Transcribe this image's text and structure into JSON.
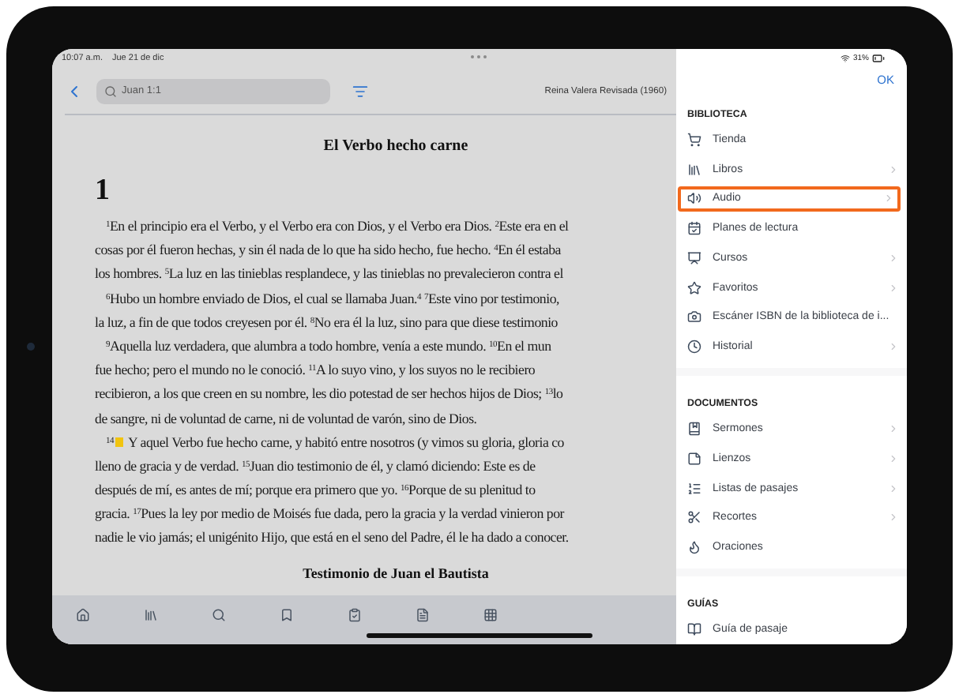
{
  "status_bar": {
    "time": "10:07 a.m.",
    "date": "Jue 21 de dic",
    "battery": "31%"
  },
  "reader": {
    "search": {
      "value": "Juan 1:1"
    },
    "version": "Reina Valera Revisada (1960)",
    "heading": "El Verbo hecho carne",
    "chapter": "1",
    "lines": [
      {
        "text": "$^{1}$En el principio era el Verbo, y el Verbo era con Dios, y el Verbo era Dios. $^{2}$Este era en el",
        "indented": true,
        "note_marker": false
      },
      {
        "text": "cosas por él fueron hechas, y sin él nada de lo que ha sido hecho, fue hecho. $^{4}$En él estaba",
        "indented": false,
        "note_marker": false
      },
      {
        "text": "los hombres. $^{5}$La luz en las tinieblas resplandece, y las tinieblas no prevalecieron contra el",
        "indented": false,
        "note_marker": false
      },
      {
        "text": "$^{6}$Hubo un hombre enviado de Dios, el cual se llamaba Juan.$^{4}$ $^{7}$Este vino por testimonio,",
        "indented": true,
        "note_marker": false
      },
      {
        "text": "la luz, a fin de que todos creyesen por él. $^{8}$No era él la luz, sino para que diese testimonio",
        "indented": false,
        "note_marker": false
      },
      {
        "text": "$^{9}$Aquella luz verdadera, que alumbra a todo hombre, venía a este mundo. $^{10}$En el mun",
        "indented": true,
        "note_marker": false
      },
      {
        "text": "fue hecho; pero el mundo no le conoció. $^{11}$A lo suyo vino, y los suyos no le recibiero",
        "indented": false,
        "note_marker": false
      },
      {
        "text": "recibieron, a los que creen en su nombre, les dio potestad de ser hechos hijos de Dios; $^{13}$lo",
        "indented": false,
        "note_marker": false
      },
      {
        "text": "de sangre, ni de voluntad de carne, ni de voluntad de varón, sino de Dios.",
        "indented": false,
        "note_marker": false
      },
      {
        "text": "$^{14}$",
        "indented": true,
        "note_marker": true,
        "after_marker": "Y aquel Verbo fue hecho carne, y habitó entre nosotros (y vimos su gloria, gloria co"
      },
      {
        "text": "lleno de gracia y de verdad. $^{15}$Juan dio testimonio de él, y clamó diciendo: Este es de",
        "indented": false,
        "note_marker": false
      },
      {
        "text": "después de mí, es antes de mí; porque era primero que yo. $^{16}$Porque de su plenitud to",
        "indented": false,
        "note_marker": false
      },
      {
        "text": "gracia. $^{17}$Pues la ley por medio de Moisés fue dada, pero la gracia y la verdad vinieron por",
        "indented": false,
        "note_marker": false
      },
      {
        "text": "nadie le vio jamás; el unigénito Hijo, que está en el seno del Padre, él le ha dado a conocer.",
        "indented": false,
        "note_marker": false
      }
    ],
    "next_heading": "Testimonio de Juan el Bautista"
  },
  "menu": {
    "done": "OK",
    "sections": [
      {
        "title": "BIBLIOTECA",
        "items": [
          {
            "label": "Tienda",
            "chevron": false,
            "selected": false
          },
          {
            "label": "Libros",
            "chevron": true,
            "selected": false
          },
          {
            "label": "Audio",
            "chevron": true,
            "selected": true
          },
          {
            "label": "Planes de lectura",
            "chevron": false,
            "selected": false
          },
          {
            "label": "Cursos",
            "chevron": true,
            "selected": false
          },
          {
            "label": "Favoritos",
            "chevron": true,
            "selected": false
          },
          {
            "label": "Escáner ISBN de la biblioteca de i...",
            "chevron": false,
            "selected": false
          },
          {
            "label": "Historial",
            "chevron": true,
            "selected": false
          }
        ]
      },
      {
        "title": "DOCUMENTOS",
        "items": [
          {
            "label": "Sermones",
            "chevron": true,
            "selected": false
          },
          {
            "label": "Lienzos",
            "chevron": true,
            "selected": false
          },
          {
            "label": "Listas de pasajes",
            "chevron": true,
            "selected": false
          },
          {
            "label": "Recortes",
            "chevron": true,
            "selected": false
          },
          {
            "label": "Oraciones",
            "chevron": false,
            "selected": false
          }
        ]
      },
      {
        "title": "GUÍAS",
        "items": [
          {
            "label": "Guía de pasaje",
            "chevron": false,
            "selected": false
          }
        ]
      }
    ]
  }
}
